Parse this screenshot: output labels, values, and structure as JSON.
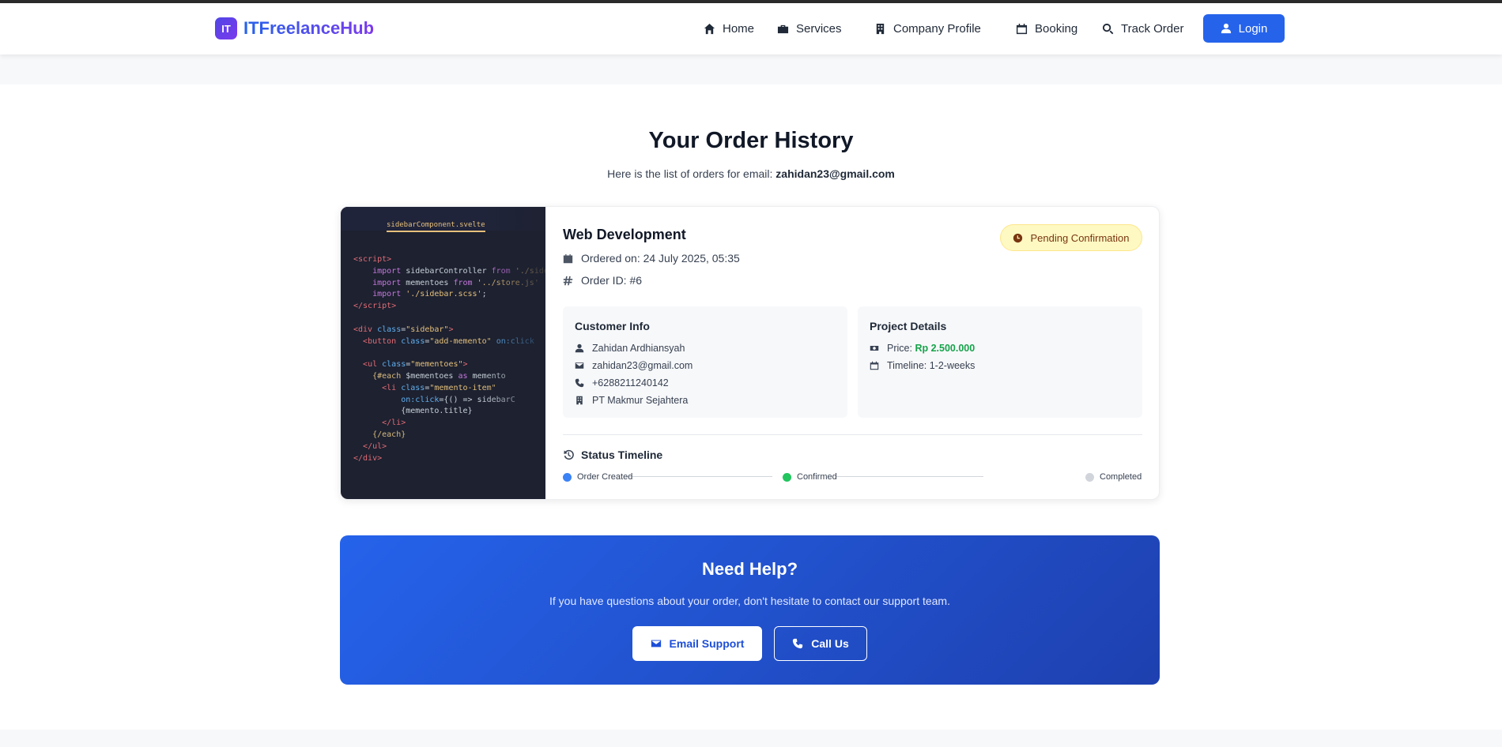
{
  "brand": {
    "badge": "IT",
    "name": "ITFreelanceHub"
  },
  "nav": {
    "home": "Home",
    "services": "Services",
    "company_profile": "Company Profile",
    "booking": "Booking",
    "track_order": "Track Order",
    "login": "Login"
  },
  "page": {
    "title": "Your Order History",
    "subtitle_prefix": "Here is the list of orders for email: ",
    "email": "zahidan23@gmail.com"
  },
  "order": {
    "service": "Web Development",
    "ordered_on": "Ordered on: 24 July 2025, 05:35",
    "order_id": "Order ID: #6",
    "status": "Pending Confirmation",
    "status_color": "#fef9c3",
    "customer": {
      "title": "Customer Info",
      "name": "Zahidan Ardhiansyah",
      "email": "zahidan23@gmail.com",
      "phone": "+6288211240142",
      "company": "PT Makmur Sejahtera"
    },
    "project": {
      "title": "Project Details",
      "price_label": "Price: ",
      "price_value": "Rp 2.500.000",
      "timeline": "Timeline: 1-2-weeks"
    },
    "timeline": {
      "title": "Status Timeline",
      "steps": [
        {
          "label": "Order Created",
          "color": "#3b82f6"
        },
        {
          "label": "Confirmed",
          "color": "#22c55e"
        },
        {
          "label": "Completed",
          "color": "#d1d5db"
        }
      ]
    },
    "image": {
      "tab_label": "sidebarComponent.svelte"
    }
  },
  "help": {
    "title": "Need Help?",
    "text": "If you have questions about your order, don't hesitate to contact our support team.",
    "email_btn": "Email Support",
    "call_btn": "Call Us"
  }
}
